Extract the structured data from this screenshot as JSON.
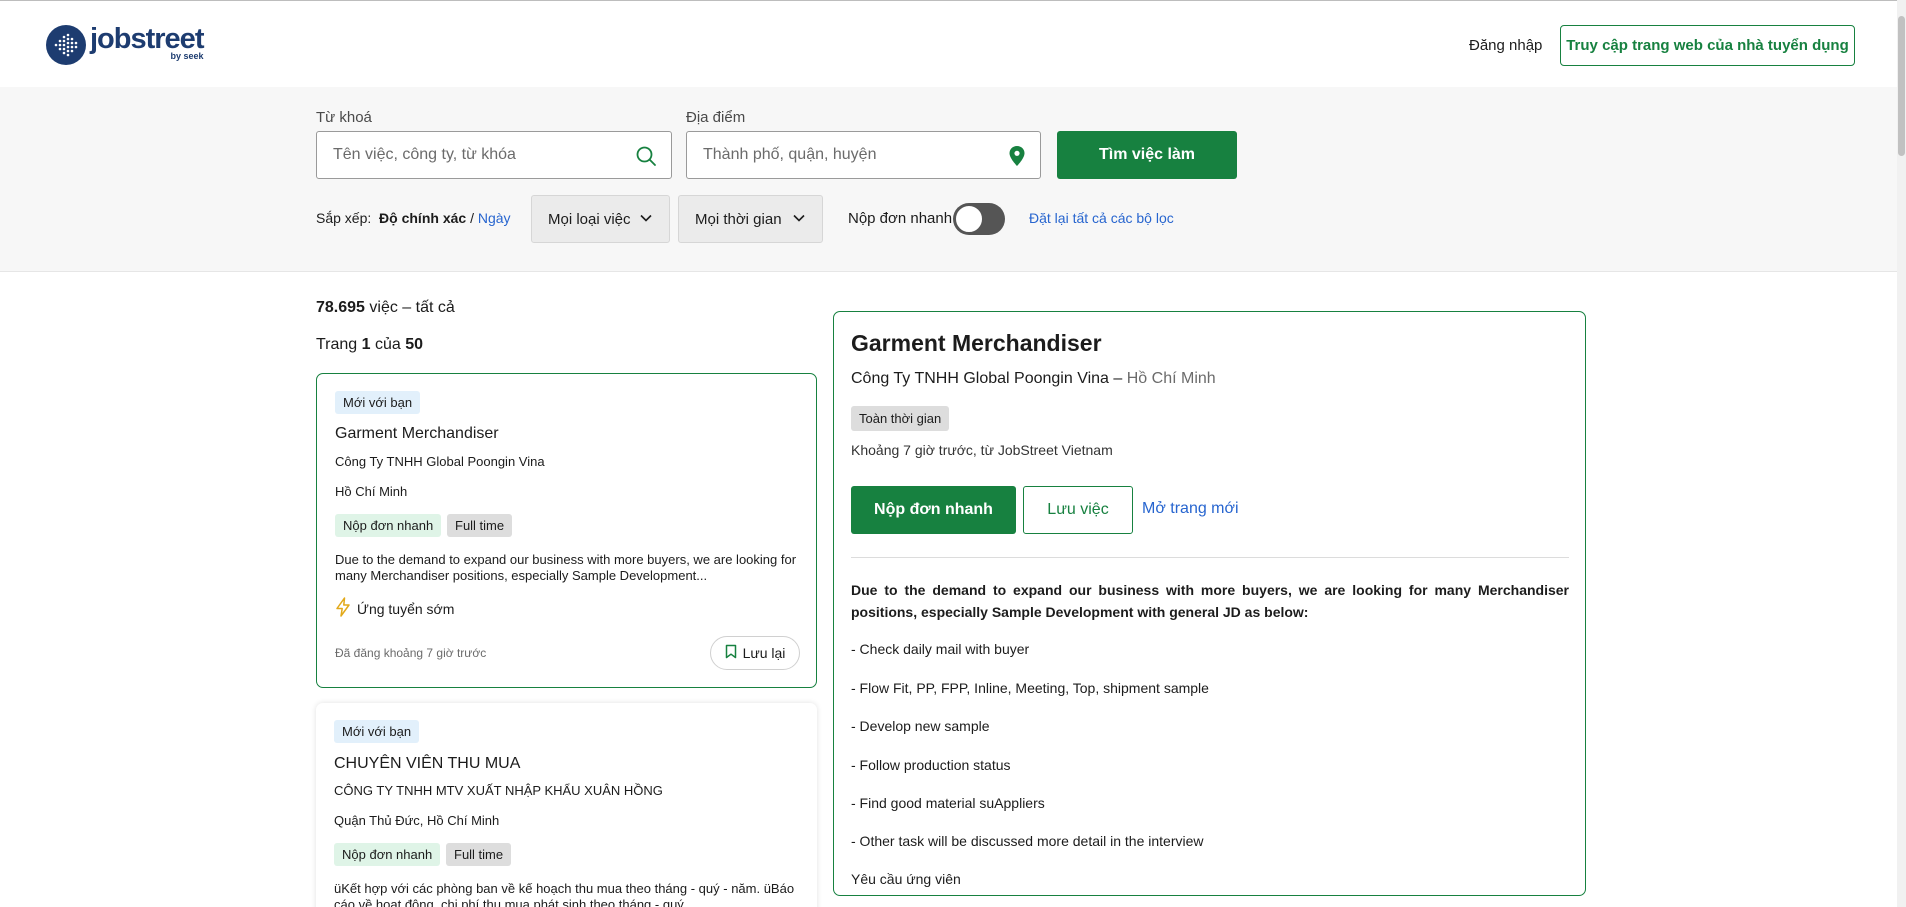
{
  "header": {
    "logo_word": "jobstreet",
    "logo_by": "by seek",
    "login_label": "Đăng nhập",
    "employer_label": "Truy cập trang web của nhà tuyển dụng"
  },
  "search": {
    "keyword_label": "Từ khoá",
    "keyword_placeholder": "Tên việc, công ty, từ khóa",
    "location_label": "Địa điểm",
    "location_placeholder": "Thành phố, quận, huyện",
    "find_label": "Tìm việc làm"
  },
  "filters": {
    "sort_prefix": "Sắp xếp:",
    "sort_active": "Độ chính xác",
    "sort_sep": "/",
    "sort_alt": "Ngày",
    "job_type": "Mọi loại việc",
    "time": "Mọi thời gian",
    "quick_apply": "Nộp đơn nhanh",
    "quick_apply_on": false,
    "reset": "Đặt lại tất cả các bộ lọc"
  },
  "results": {
    "count": "78.695",
    "count_suffix": "việc – tất cả",
    "page_prefix": "Trang",
    "page_current": "1",
    "page_of": "của",
    "page_total": "50"
  },
  "cards": [
    {
      "badge": "Mới với bạn",
      "title": "Garment Merchandiser",
      "company": "Công Ty TNHH Global Poongin Vina",
      "location": "Hồ Chí Minh",
      "tag_quick": "Nộp đơn nhanh",
      "tag_type": "Full time",
      "description": "Due to the demand to expand our business with more buyers, we are looking for many Merchandiser positions, especially Sample Development...",
      "early": "Ứng tuyển sớm",
      "posted": "Đã đăng khoảng 7 giờ trước",
      "save": "Lưu lại"
    },
    {
      "badge": "Mới với bạn",
      "title": "CHUYÊN VIÊN THU MUA",
      "company": "CÔNG TY TNHH MTV XUẤT NHẬP KHẨU XUÂN HỒNG",
      "location": "Quận Thủ Đức, Hồ Chí Minh",
      "tag_quick": "Nộp đơn nhanh",
      "tag_type": "Full time",
      "description": "üKết hợp với các phòng ban về kế hoạch thu mua theo tháng - quý - năm. üBáo cáo về hoạt động, chi phí thu mua phát sinh theo tháng - quý..."
    }
  ],
  "detail": {
    "title": "Garment Merchandiser",
    "company": "Công Ty TNHH Global Poongin Vina",
    "location_sep": "–",
    "location": "Hồ Chí Minh",
    "work_type": "Toàn thời gian",
    "posted": "Khoảng 7 giờ trước, từ JobStreet Vietnam",
    "apply_label": "Nộp đơn nhanh",
    "save_label": "Lưu việc",
    "open_label": "Mở trang mới",
    "lead": "Due to the demand to expand our business with more buyers, we are looking for many Merchandiser positions, especially Sample Development with general JD as below:",
    "lines": [
      "- Check daily mail with buyer",
      "- Flow Fit, PP, FPP, Inline, Meeting, Top, shipment sample",
      "- Develop new sample",
      "- Follow production status",
      "- Find good material suAppliers",
      "- Other task will be discussed more detail in the interview",
      "Yêu cầu ứng viên"
    ]
  },
  "colors": {
    "brand_green": "#178140",
    "brand_navy": "#1d3c70",
    "link_blue": "#2765cf"
  }
}
